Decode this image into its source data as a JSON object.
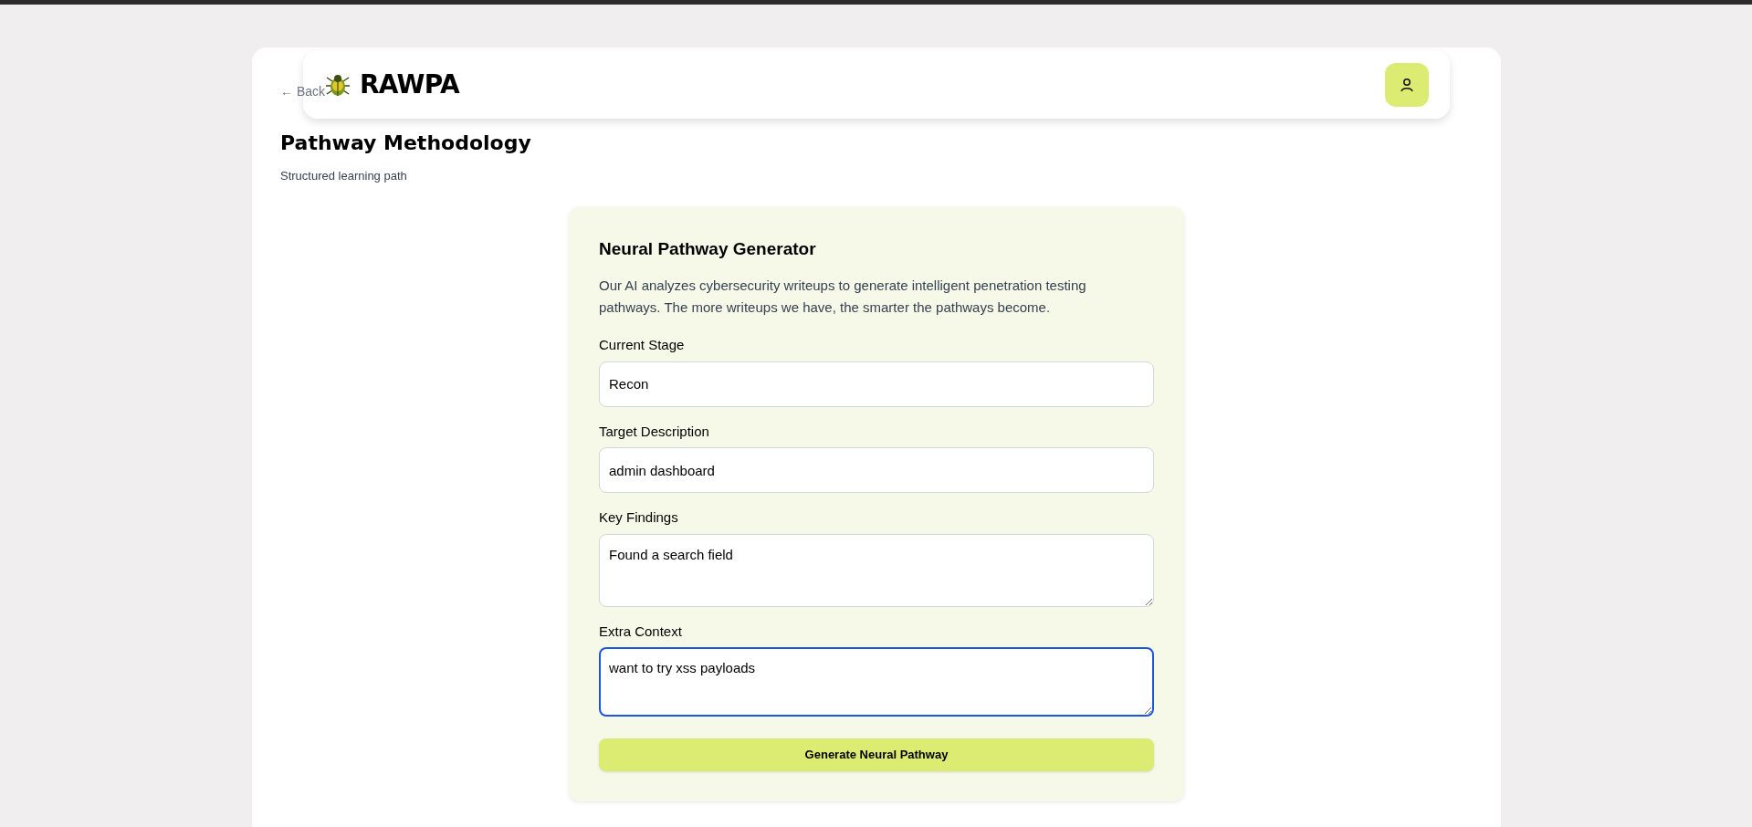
{
  "header": {
    "logo_text": "RAWPA"
  },
  "back_link": "← Back",
  "page": {
    "title": "Pathway Methodology",
    "subtitle": "Structured learning path"
  },
  "generator": {
    "title": "Neural Pathway Generator",
    "description": "Our AI analyzes cybersecurity writeups to generate intelligent penetration testing pathways. The more writeups we have, the smarter the pathways become.",
    "fields": [
      {
        "label": "Current Stage",
        "kind": "input",
        "value": "Recon",
        "focused": false
      },
      {
        "label": "Target Description",
        "kind": "input",
        "value": "admin dashboard",
        "focused": false
      },
      {
        "label": "Key Findings",
        "kind": "textarea",
        "value": "Found a search field",
        "focused": false
      },
      {
        "label": "Extra Context",
        "kind": "textarea",
        "value": "want to try xss payloads",
        "focused": true
      }
    ],
    "button": "Generate Neural Pathway"
  }
}
